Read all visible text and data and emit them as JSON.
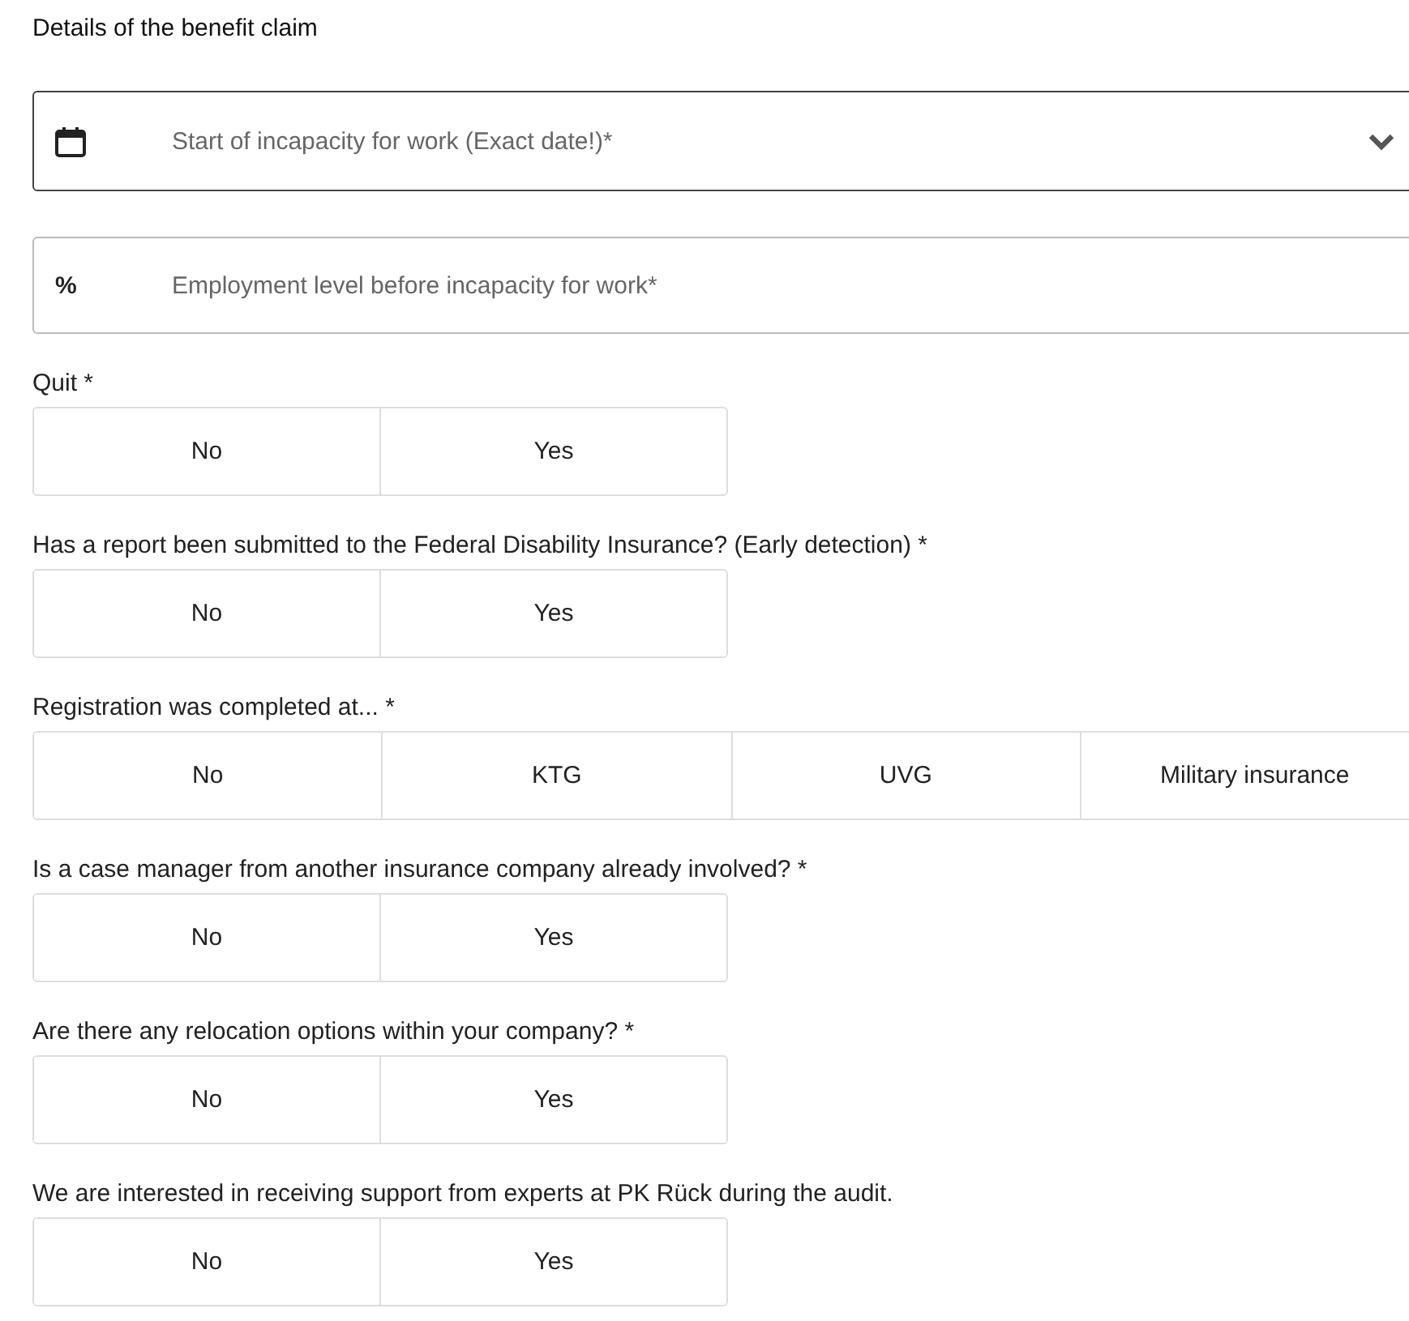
{
  "section": {
    "title": "Details of the benefit claim"
  },
  "fields": [
    {
      "kind": "date",
      "placeholder": "Start of incapacity for work (Exact date!)*",
      "focused": true
    },
    {
      "kind": "percent",
      "prefix": "%",
      "placeholder": "Employment level before incapacity for work*",
      "focused": false
    }
  ],
  "questions": [
    {
      "label": "Quit *",
      "options": [
        {
          "label": "No",
          "selected": false
        },
        {
          "label": "Yes",
          "selected": false
        }
      ]
    },
    {
      "label": "Has a report been submitted to the Federal Disability Insurance? (Early detection) *",
      "options": [
        {
          "label": "No",
          "selected": false
        },
        {
          "label": "Yes",
          "selected": false
        }
      ]
    },
    {
      "label": "Registration was completed at... *",
      "options": [
        {
          "label": "No",
          "selected": false
        },
        {
          "label": "KTG",
          "selected": false
        },
        {
          "label": "UVG",
          "selected": false
        },
        {
          "label": "Military insurance",
          "selected": false
        }
      ]
    },
    {
      "label": "Is a case manager from another insurance company already involved? *",
      "options": [
        {
          "label": "No",
          "selected": false
        },
        {
          "label": "Yes",
          "selected": false
        }
      ]
    },
    {
      "label": "Are there any relocation options within your company? *",
      "options": [
        {
          "label": "No",
          "selected": false
        },
        {
          "label": "Yes",
          "selected": false
        }
      ]
    },
    {
      "label": "We are interested in receiving support from experts at PK Rück during the audit.",
      "options": [
        {
          "label": "No",
          "selected": false
        },
        {
          "label": "Yes",
          "selected": false
        }
      ]
    }
  ]
}
